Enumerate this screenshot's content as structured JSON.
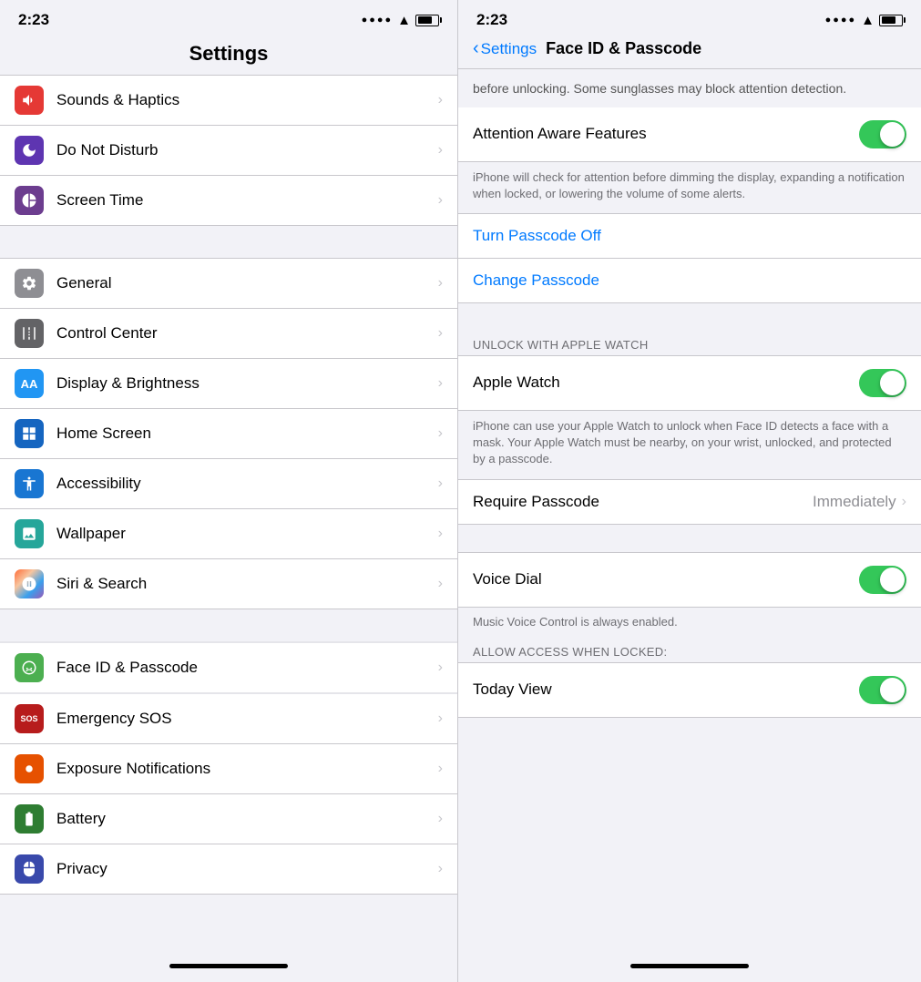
{
  "left": {
    "status": {
      "time": "2:23"
    },
    "title": "Settings",
    "items_group1": [
      {
        "id": "sounds-haptics",
        "label": "Sounds & Haptics",
        "icon_color": "bg-red",
        "icon": "🔊"
      },
      {
        "id": "do-not-disturb",
        "label": "Do Not Disturb",
        "icon_color": "bg-purple",
        "icon": "🌙"
      },
      {
        "id": "screen-time",
        "label": "Screen Time",
        "icon_color": "bg-purple2",
        "icon": "⏳"
      }
    ],
    "items_group2": [
      {
        "id": "general",
        "label": "General",
        "icon_color": "bg-gray",
        "icon": "⚙️"
      },
      {
        "id": "control-center",
        "label": "Control Center",
        "icon_color": "bg-gray2",
        "icon": "🎛"
      },
      {
        "id": "display-brightness",
        "label": "Display & Brightness",
        "icon_color": "bg-blue",
        "icon": "AA"
      },
      {
        "id": "home-screen",
        "label": "Home Screen",
        "icon_color": "bg-blue2",
        "icon": "⊞"
      },
      {
        "id": "accessibility",
        "label": "Accessibility",
        "icon_color": "bg-blue",
        "icon": "♿"
      },
      {
        "id": "wallpaper",
        "label": "Wallpaper",
        "icon_color": "bg-teal",
        "icon": "🌸"
      },
      {
        "id": "siri-search",
        "label": "Siri & Search",
        "icon_color": "bg-indigo",
        "icon": "🌈"
      }
    ],
    "items_group3": [
      {
        "id": "face-id-passcode",
        "label": "Face ID & Passcode",
        "icon_color": "bg-face-green",
        "icon": "😊",
        "selected": true
      },
      {
        "id": "emergency-sos",
        "label": "Emergency SOS",
        "icon_color": "bg-dark-red",
        "icon": "SOS"
      },
      {
        "id": "exposure-notifications",
        "label": "Exposure Notifications",
        "icon_color": "bg-orange",
        "icon": "🔴"
      },
      {
        "id": "battery",
        "label": "Battery",
        "icon_color": "bg-green2",
        "icon": "🔋"
      },
      {
        "id": "privacy",
        "label": "Privacy",
        "icon_color": "bg-indigo",
        "icon": "✋"
      }
    ],
    "home_bar": ""
  },
  "right": {
    "status": {
      "time": "2:23"
    },
    "back_label": "Settings",
    "title": "Face ID & Passcode",
    "top_text": "before unlocking. Some sunglasses may block attention detection.",
    "attention_aware": {
      "label": "Attention Aware Features",
      "state": "on"
    },
    "attention_desc": "iPhone will check for attention before dimming the display, expanding a notification when locked, or lowering the volume of some alerts.",
    "turn_passcode_off": "Turn Passcode Off",
    "change_passcode": "Change Passcode",
    "unlock_with_watch_label": "UNLOCK WITH APPLE WATCH",
    "apple_watch": {
      "label": "Apple Watch",
      "state": "on"
    },
    "apple_watch_desc": "iPhone can use your Apple Watch to unlock when Face ID detects a face with a mask. Your Apple Watch must be nearby, on your wrist, unlocked, and protected by a passcode.",
    "require_passcode": {
      "label": "Require Passcode",
      "value": "Immediately"
    },
    "voice_dial": {
      "label": "Voice Dial",
      "state": "on"
    },
    "voice_dial_desc": "Music Voice Control is always enabled.",
    "allow_access_locked_label": "ALLOW ACCESS WHEN LOCKED:",
    "today_view": {
      "label": "Today View",
      "state": "on"
    }
  }
}
